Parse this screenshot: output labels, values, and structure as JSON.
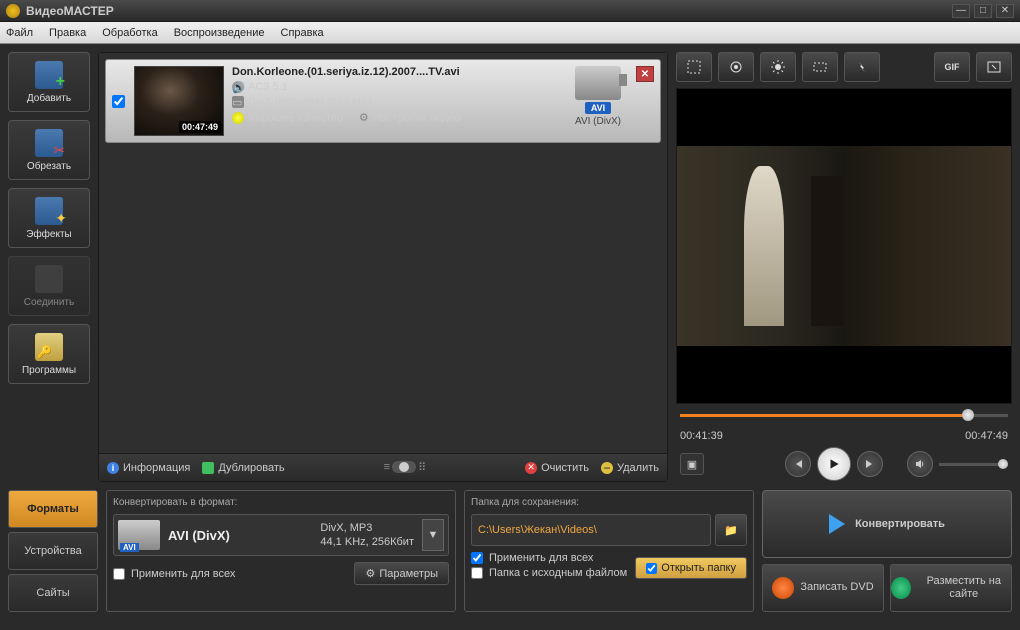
{
  "title": "ВидеоМАСТЕР",
  "menu": [
    "Файл",
    "Правка",
    "Обработка",
    "Воспроизведение",
    "Справка"
  ],
  "sidebar": [
    {
      "label": "Добавить",
      "icon": "add-icon"
    },
    {
      "label": "Обрезать",
      "icon": "cut-icon"
    },
    {
      "label": "Эффекты",
      "icon": "effects-icon"
    },
    {
      "label": "Соединить",
      "icon": "join-icon",
      "disabled": true
    },
    {
      "label": "Программы",
      "icon": "programs-icon"
    }
  ],
  "file": {
    "name": "Don.Korleone.(01.seriya.iz.12).2007....TV.avi",
    "duration": "00:47:49",
    "audio": "AC3 5.1",
    "video": "DivX (688x384) (953 МБ)",
    "quality": "Хорошее качество",
    "settings": "Настройки видео",
    "format_badge": "AVI",
    "format_text": "AVI (DivX)"
  },
  "listbar": {
    "info": "Информация",
    "dup": "Дублировать",
    "clear": "Очистить",
    "del": "Удалить"
  },
  "preview": {
    "cur": "00:41:39",
    "total": "00:47:49"
  },
  "tabs": [
    "Форматы",
    "Устройства",
    "Сайты"
  ],
  "format_panel": {
    "header": "Конвертировать в формат:",
    "name": "AVI (DivX)",
    "detail1": "DivX, MP3",
    "detail2": "44,1 KHz, 256Кбит",
    "badge": "AVI",
    "apply_all": "Применить для всех",
    "params": "Параметры"
  },
  "save_panel": {
    "header": "Папка для сохранения:",
    "path": "C:\\Users\\Жекан\\Videos\\",
    "apply_all": "Применить для всех",
    "src_folder": "Папка с исходным файлом",
    "open": "Открыть папку"
  },
  "convert": {
    "main": "Конвертировать",
    "dvd": "Записать DVD",
    "site": "Разместить на сайте"
  }
}
